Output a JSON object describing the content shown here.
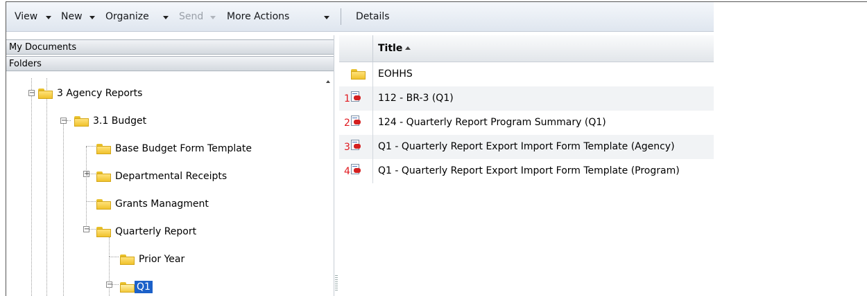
{
  "toolbar": {
    "view": "View",
    "new": "New",
    "organize": "Organize",
    "send": "Send",
    "more_actions": "More Actions",
    "details": "Details"
  },
  "left_panel": {
    "my_documents": "My Documents",
    "folders": "Folders",
    "tree": [
      {
        "label": "3 Agency Reports",
        "expander": "minus"
      },
      {
        "label": "3.1 Budget",
        "expander": "minus"
      },
      {
        "label": "Base Budget Form Template",
        "expander": "none"
      },
      {
        "label": "Departmental Receipts",
        "expander": "plus"
      },
      {
        "label": "Grants Managment",
        "expander": "none"
      },
      {
        "label": "Quarterly Report",
        "expander": "minus"
      },
      {
        "label": "Prior Year",
        "expander": "none"
      },
      {
        "label": "Q1",
        "expander": "minus",
        "selected": true
      }
    ]
  },
  "grid": {
    "title_header": "Title",
    "rows": [
      {
        "num": "",
        "icon": "folder-icon",
        "title": "EOHHS"
      },
      {
        "num": "1",
        "icon": "report-document-icon",
        "title": "112 - BR-3 (Q1)"
      },
      {
        "num": "2",
        "icon": "report-document-icon",
        "title": "124 - Quarterly Report Program Summary (Q1)"
      },
      {
        "num": "3",
        "icon": "report-document-icon",
        "title": "Q1 - Quarterly Report Export Import Form Template (Agency)"
      },
      {
        "num": "4",
        "icon": "report-document-icon",
        "title": "Q1 - Quarterly Report Export Import Form Template (Program)"
      }
    ]
  },
  "colors": {
    "selection": "#1c61c9",
    "annotation_numbers": "#e0191f",
    "folder": "#f0c22d"
  }
}
